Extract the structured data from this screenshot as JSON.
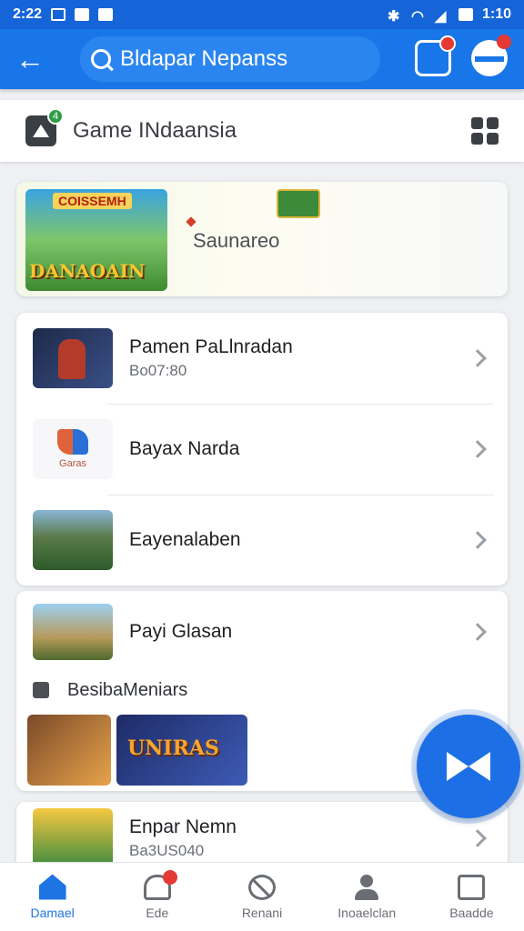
{
  "status_bar": {
    "time": "2:22",
    "clock": "1:10"
  },
  "app_bar": {
    "back_icon": "arrow-left-icon",
    "search_text": "Bldapar Nepanss"
  },
  "sub_header": {
    "title": "Game INdaansia",
    "badge": "4"
  },
  "banner": {
    "art_tag": "COISSEMH",
    "art_title": "DANAOAIN",
    "label": "Saunareo"
  },
  "list_card": {
    "items": [
      {
        "title": "Pamen PaLlnradan",
        "subtitle": "Bo07:80"
      },
      {
        "title": "Bayax Narda",
        "thumb_caption": "Garas"
      },
      {
        "title": "Eayenalaben"
      }
    ]
  },
  "media_card": {
    "item_title": "Payi Glasan",
    "section_label": "BesibaMeniars",
    "media_wordmark": "UNIRAS"
  },
  "partial_card": {
    "title": "Enpar Nemn",
    "subtitle": "Ba3US040"
  },
  "bottom_nav": {
    "items": [
      {
        "label": "Damael",
        "icon": "home-icon",
        "active": true
      },
      {
        "label": "Ede",
        "icon": "bell-icon"
      },
      {
        "label": "Renani",
        "icon": "block-icon"
      },
      {
        "label": "Inoaelclan",
        "icon": "person-icon"
      },
      {
        "label": "Baadde",
        "icon": "box-icon"
      }
    ]
  },
  "colors": {
    "primary": "#1976e8",
    "badge": "#e53935",
    "background": "#eef0f3"
  }
}
